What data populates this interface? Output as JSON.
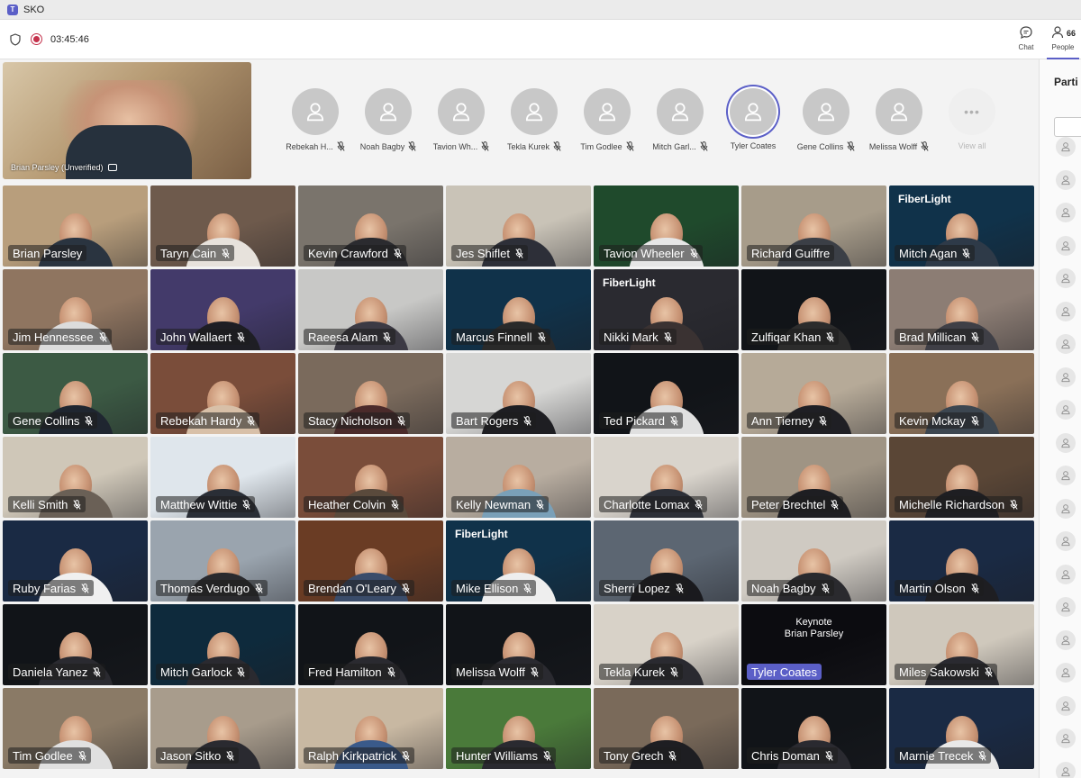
{
  "window": {
    "title": "SKO"
  },
  "toolbar": {
    "timer": "03:45:46",
    "chat_label": "Chat",
    "people_label": "People",
    "people_count": "66"
  },
  "self_view": {
    "name": "Brian Parsley (Unverified)"
  },
  "strip": [
    {
      "name": "Rebekah H...",
      "muted": true
    },
    {
      "name": "Noah Bagby",
      "muted": true
    },
    {
      "name": "Tavion Wh...",
      "muted": true
    },
    {
      "name": "Tekla Kurek",
      "muted": true
    },
    {
      "name": "Tim Godlee",
      "muted": true
    },
    {
      "name": "Mitch Garl...",
      "muted": true
    },
    {
      "name": "Tyler Coates",
      "muted": false,
      "speaking": true
    },
    {
      "name": "Gene Collins",
      "muted": true
    },
    {
      "name": "Melissa Wolff",
      "muted": true
    },
    {
      "name": "View all",
      "more": true
    }
  ],
  "grid": [
    {
      "name": "Brian Parsley",
      "bg": "#b89e7c",
      "shirt": "#2a3440",
      "muted": false
    },
    {
      "name": "Taryn Cain",
      "bg": "#6e5a4c",
      "shirt": "#e7e2dc",
      "muted": true
    },
    {
      "name": "Kevin Crawford",
      "bg": "#7a746c",
      "shirt": "#2b2b2f",
      "muted": true
    },
    {
      "name": "Jes Shiflet",
      "bg": "#c9c3b7",
      "shirt": "#2d2f38",
      "muted": true
    },
    {
      "name": "Tavion Wheeler",
      "bg": "#1f4a2c",
      "shirt": "#e6e6e6",
      "muted": true
    },
    {
      "name": "Richard Guiffre",
      "bg": "#a79c8a",
      "shirt": "#3b3f46",
      "muted": false
    },
    {
      "name": "Mitch Agan",
      "bg": "#10324a",
      "shirt": "#2e3a48",
      "muted": true,
      "logo": "FiberLight"
    },
    {
      "name": "Jim Hennessee",
      "bg": "#8f7560",
      "shirt": "#dcdcdc",
      "muted": true
    },
    {
      "name": "John Wallaert",
      "bg": "#433a6a",
      "shirt": "#1e1e24",
      "muted": true
    },
    {
      "name": "Raeesa Alam",
      "bg": "#c8c8c6",
      "shirt": "#3c3a44",
      "muted": true
    },
    {
      "name": "Marcus Finnell",
      "bg": "#10324a",
      "shirt": "#2a2a2a",
      "muted": true
    },
    {
      "name": "Nikki Mark",
      "bg": "#2a2a30",
      "shirt": "#3a3232",
      "muted": true,
      "logo": "FiberLight"
    },
    {
      "name": "Zulfiqar Khan",
      "bg": "#111418",
      "shirt": "#2c2c2c",
      "muted": true
    },
    {
      "name": "Brad Millican",
      "bg": "#8c7d74",
      "shirt": "#3f3f46",
      "muted": true
    },
    {
      "name": "Gene Collins",
      "bg": "#3c5a44",
      "shirt": "#1f2630",
      "muted": true
    },
    {
      "name": "Rebekah Hardy",
      "bg": "#7a4d3a",
      "shirt": "#d8c0a8",
      "muted": true
    },
    {
      "name": "Stacy Nicholson",
      "bg": "#7a6a5c",
      "shirt": "#4a2a2a",
      "muted": true
    },
    {
      "name": "Bart Rogers",
      "bg": "#d6d6d4",
      "shirt": "#1e1e22",
      "muted": true
    },
    {
      "name": "Ted Pickard",
      "bg": "#111418",
      "shirt": "#e0e0e0",
      "muted": true
    },
    {
      "name": "Ann Tierney",
      "bg": "#b6aa98",
      "shirt": "#1f1f24",
      "muted": true
    },
    {
      "name": "Kevin Mckay",
      "bg": "#8a7058",
      "shirt": "#3c4650",
      "muted": true
    },
    {
      "name": "Kelli Smith",
      "bg": "#cfc7b8",
      "shirt": "#6a6056",
      "muted": true
    },
    {
      "name": "Matthew Wittie",
      "bg": "#dfe6ec",
      "shirt": "#2a2e36",
      "muted": true
    },
    {
      "name": "Heather Colvin",
      "bg": "#7a4d3a",
      "shirt": "#5a4a3c",
      "muted": true
    },
    {
      "name": "Kelly Newman",
      "bg": "#b8ada0",
      "shirt": "#7aa0b8",
      "muted": true
    },
    {
      "name": "Charlotte Lomax",
      "bg": "#d9d4cc",
      "shirt": "#2d3038",
      "muted": true
    },
    {
      "name": "Peter Brechtel",
      "bg": "#9f9484",
      "shirt": "#1e1e22",
      "muted": true
    },
    {
      "name": "Michelle Richardson",
      "bg": "#5a4636",
      "shirt": "#1e1e22",
      "muted": true
    },
    {
      "name": "Ruby Farias",
      "bg": "#1a2a44",
      "shirt": "#f0f0f0",
      "muted": true
    },
    {
      "name": "Thomas Verdugo",
      "bg": "#9aa4ae",
      "shirt": "#2a2a2e",
      "muted": true
    },
    {
      "name": "Brendan O'Leary",
      "bg": "#6a3c24",
      "shirt": "#3a4c6a",
      "muted": true
    },
    {
      "name": "Mike Ellison",
      "bg": "#10324a",
      "shirt": "#eeeeee",
      "muted": true,
      "logo": "FiberLight"
    },
    {
      "name": "Sherri Lopez",
      "bg": "#5c6672",
      "shirt": "#1a1a1e",
      "muted": true
    },
    {
      "name": "Noah Bagby",
      "bg": "#cfcac2",
      "shirt": "#2a2a2e",
      "muted": true
    },
    {
      "name": "Martin Olson",
      "bg": "#1a2a44",
      "shirt": "#1e1e22",
      "muted": true
    },
    {
      "name": "Daniela Yanez",
      "bg": "#111418",
      "shirt": "#2a2a30",
      "muted": true
    },
    {
      "name": "Mitch Garlock",
      "bg": "#0e2a3c",
      "shirt": "#2a2a30",
      "muted": true
    },
    {
      "name": "Fred Hamilton",
      "bg": "#111418",
      "shirt": "#2a2a30",
      "muted": true
    },
    {
      "name": "Melissa Wolff",
      "bg": "#111418",
      "shirt": "#2a2a30",
      "muted": true
    },
    {
      "name": "Tekla Kurek",
      "bg": "#d8d2c8",
      "shirt": "#2a2a30",
      "muted": true
    },
    {
      "name": "Tyler Coates",
      "bg": "#0c0c10",
      "shirt": "#0c0c10",
      "muted": false,
      "highlight": true,
      "overlay": [
        "Keynote",
        "Brian Parsley"
      ]
    },
    {
      "name": "Miles Sakowski",
      "bg": "#cfc8bc",
      "shirt": "#2a2a30",
      "muted": true
    },
    {
      "name": "Tim Godlee",
      "bg": "#8a7a66",
      "shirt": "#e0e0e0",
      "muted": true
    },
    {
      "name": "Jason Sitko",
      "bg": "#a89c8c",
      "shirt": "#2a2a30",
      "muted": true
    },
    {
      "name": "Ralph Kirkpatrick",
      "bg": "#c8b8a2",
      "shirt": "#3a5a8a",
      "muted": true
    },
    {
      "name": "Hunter Williams",
      "bg": "#4a7a3a",
      "shirt": "#2a2a30",
      "muted": true
    },
    {
      "name": "Tony Grech",
      "bg": "#7a6a5a",
      "shirt": "#1e1e22",
      "muted": true
    },
    {
      "name": "Chris Doman",
      "bg": "#111418",
      "shirt": "#2a2a30",
      "muted": true
    },
    {
      "name": "Marnie Trecek",
      "bg": "#1a2a44",
      "shirt": "#e8e8e8",
      "muted": true
    }
  ],
  "people_panel": {
    "title": "Parti",
    "avatar_count": 20
  }
}
